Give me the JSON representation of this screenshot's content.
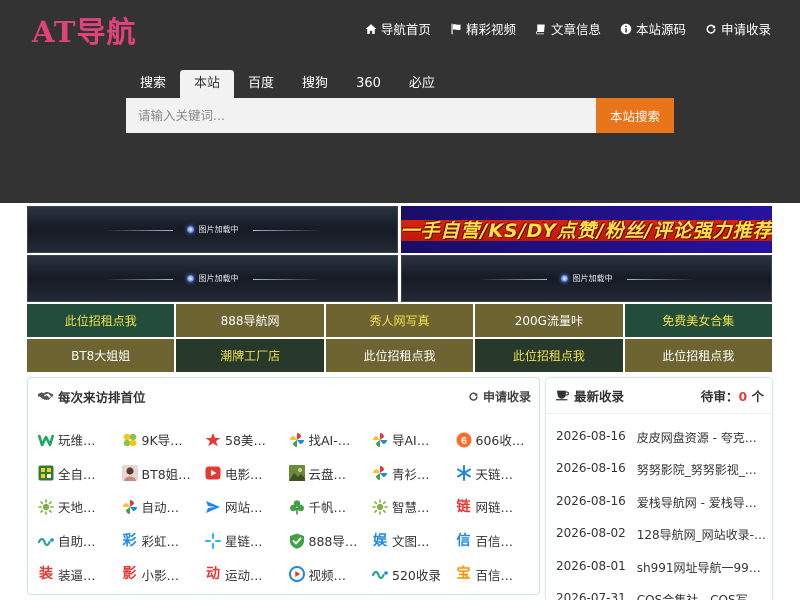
{
  "brand": {
    "logo": "AT导航"
  },
  "topnav": [
    {
      "label": "导航首页",
      "icon": "home-icon"
    },
    {
      "label": "精彩视频",
      "icon": "flag-icon"
    },
    {
      "label": "文章信息",
      "icon": "book-icon"
    },
    {
      "label": "本站源码",
      "icon": "info-icon"
    },
    {
      "label": "申请收录",
      "icon": "refresh-icon"
    }
  ],
  "search": {
    "tabs": [
      "搜索",
      "本站",
      "百度",
      "搜狗",
      "360",
      "必应"
    ],
    "active_tab": "本站",
    "placeholder": "请输入关键词...",
    "button": "本站搜索"
  },
  "banners": {
    "loading_text": "图片加载中",
    "ad_text": "一手自营/KS/DY点赞/粉丝/评论强力推荐"
  },
  "promo": [
    {
      "label": "此位招租点我",
      "bg": "#214d3a",
      "color": "#f3e04a"
    },
    {
      "label": "888导航网",
      "bg": "#6e6432",
      "color": "#ffffff"
    },
    {
      "label": "秀人网写真",
      "bg": "#6e6432",
      "color": "#f3e04a"
    },
    {
      "label": "200G流量咔",
      "bg": "#6e6432",
      "color": "#ffffff"
    },
    {
      "label": "免费美女合集",
      "bg": "#214d3a",
      "color": "#f3e04a"
    },
    {
      "label": "BT8大姐姐",
      "bg": "#6e6432",
      "color": "#ffffff"
    },
    {
      "label": "潮牌工厂店",
      "bg": "#26392a",
      "color": "#f3e04a"
    },
    {
      "label": "此位招租点我",
      "bg": "#6e6432",
      "color": "#ffffff"
    },
    {
      "label": "此位招租点我",
      "bg": "#26392a",
      "color": "#f3e04a"
    },
    {
      "label": "此位招租点我",
      "bg": "#6e6432",
      "color": "#ffffff"
    }
  ],
  "visitors": {
    "title": "每次来访排首位",
    "apply": "申请收录",
    "sites": [
      {
        "name": "玩维…",
        "icon": "w-logo-icon"
      },
      {
        "name": "9K导…",
        "icon": "clover-logo-icon"
      },
      {
        "name": "58美…",
        "icon": "star-icon"
      },
      {
        "name": "找AI-…",
        "icon": "pinwheel-icon"
      },
      {
        "name": "导AI…",
        "icon": "pinwheel-icon"
      },
      {
        "name": "606收…",
        "icon": "six-badge-icon"
      },
      {
        "name": "全自…",
        "icon": "qr-logo-icon"
      },
      {
        "name": "BT8姐…",
        "icon": "avatar-icon"
      },
      {
        "name": "电影…",
        "icon": "play-icon"
      },
      {
        "name": "云盘…",
        "icon": "photo-icon"
      },
      {
        "name": "青衫…",
        "icon": "pinwheel-icon"
      },
      {
        "name": "天链…",
        "icon": "snowflake-icon"
      },
      {
        "name": "天地…",
        "icon": "sun-icon"
      },
      {
        "name": "自动…",
        "icon": "pinwheel-icon"
      },
      {
        "name": "网站…",
        "icon": "plane-icon"
      },
      {
        "name": "千帆…",
        "icon": "clover-icon"
      },
      {
        "name": "智慧…",
        "icon": "sun-icon"
      },
      {
        "name": "网链…",
        "icon": "lian-char-icon"
      },
      {
        "name": "自助…",
        "icon": "wave-logo-icon"
      },
      {
        "name": "彩虹…",
        "icon": "cai-char-icon"
      },
      {
        "name": "星链…",
        "icon": "sparkle-icon"
      },
      {
        "name": "888导…",
        "icon": "shield-check-icon"
      },
      {
        "name": "文图…",
        "icon": "yu-char-icon"
      },
      {
        "name": "百信…",
        "icon": "xin-char-icon"
      },
      {
        "name": "装逼…",
        "icon": "zhuang-char-icon"
      },
      {
        "name": "小影…",
        "icon": "ying-char-icon"
      },
      {
        "name": "运动…",
        "icon": "dong-char-icon"
      },
      {
        "name": "视频…",
        "icon": "video-circle-icon"
      },
      {
        "name": "520收录",
        "icon": "wave-logo-icon"
      },
      {
        "name": "百信…",
        "icon": "bao-char-icon"
      }
    ]
  },
  "latest": {
    "title": "最新收录",
    "pending_label": "待审：",
    "pending_count": "0",
    "pending_unit": " 个",
    "items": [
      {
        "date": "2026-08-16",
        "title": "皮皮网盘资源 - 夸克网…"
      },
      {
        "date": "2026-08-16",
        "title": "努努影院_努努影视_努…"
      },
      {
        "date": "2026-08-16",
        "title": "爱栈导航网 - 爱栈导航 …"
      },
      {
        "date": "2026-08-02",
        "title": "128导航网_网站收录-…"
      },
      {
        "date": "2026-08-01",
        "title": "sh991网址导航一991自…"
      },
      {
        "date": "2026-07-31",
        "title": "COS合集社 - COS写真…"
      }
    ]
  },
  "colors": {
    "header_bg": "#333333",
    "logo": "#e0427a",
    "search_button": "#e8751a"
  }
}
